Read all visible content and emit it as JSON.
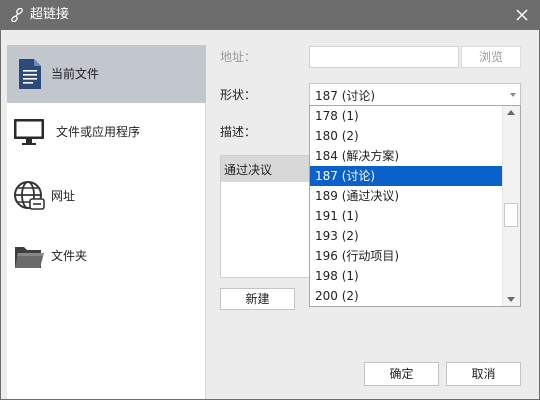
{
  "window": {
    "title": "超链接"
  },
  "sidebar": {
    "items": [
      {
        "label": "当前文件",
        "icon": "document-icon",
        "active": true
      },
      {
        "label": "文件或应用程序",
        "icon": "monitor-icon",
        "active": false
      },
      {
        "label": "网址",
        "icon": "globe-icon",
        "active": false
      },
      {
        "label": "文件夹",
        "icon": "folder-icon",
        "active": false
      }
    ]
  },
  "form": {
    "address_label": "地址：",
    "address_value": "",
    "browse_label": "浏览",
    "shape_label": "形状：",
    "shape_value": "187 (讨论)",
    "desc_label": "描述：",
    "desc_value": "通过决议",
    "new_label": "新建"
  },
  "dropdown": {
    "options": [
      "178 (1)",
      "180 (2)",
      "184 (解决方案)",
      "187 (讨论)",
      "189 (通过决议)",
      "191 (1)",
      "193 (2)",
      "196 (行动项目)",
      "198 (1)",
      "200 (2)"
    ],
    "selected_index": 3
  },
  "footer": {
    "ok_label": "确定",
    "cancel_label": "取消"
  },
  "colors": {
    "titlebar": "#6d6d6d",
    "active_sidebar": "#c2c6cd",
    "selection": "#0a61c9",
    "dialog_bg": "#ececec"
  }
}
